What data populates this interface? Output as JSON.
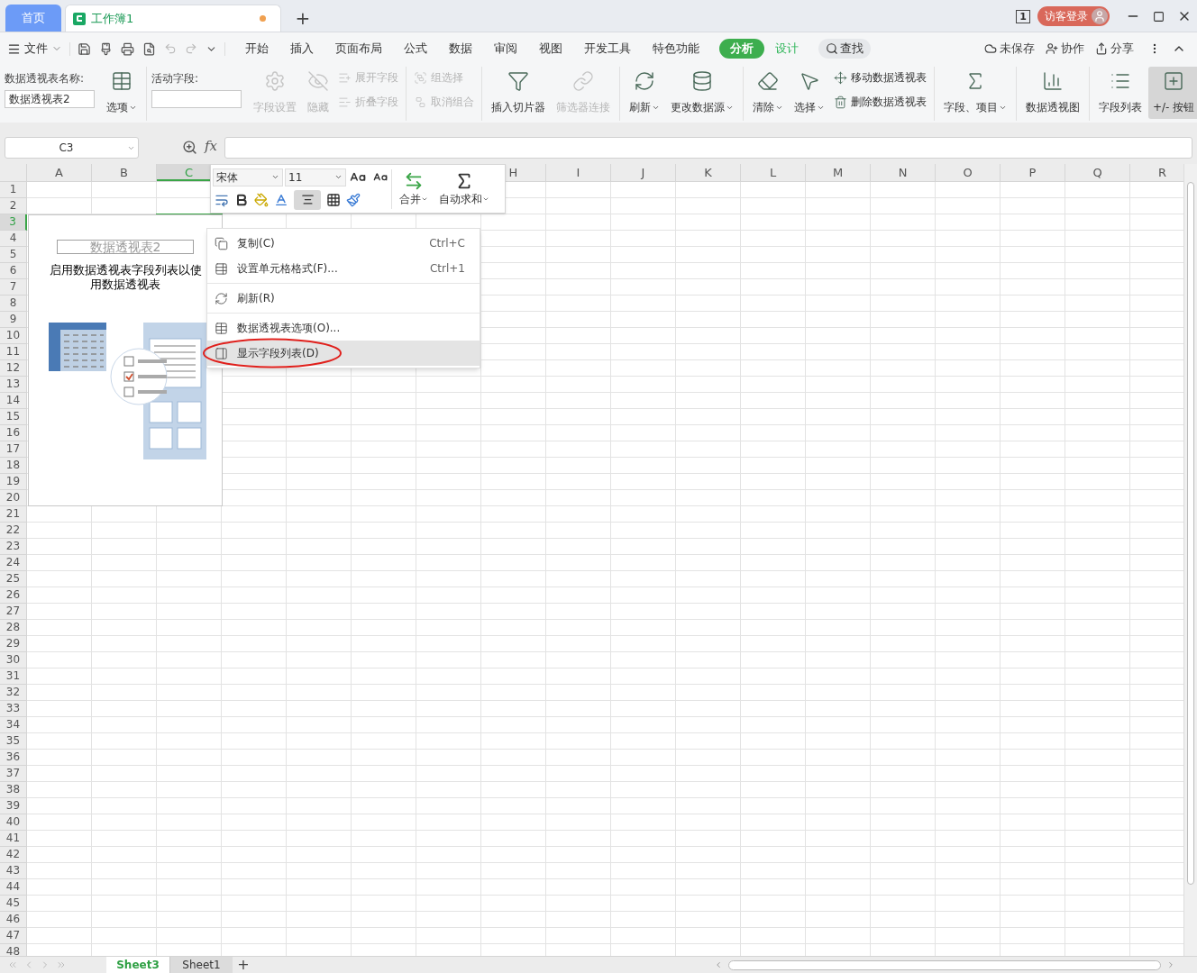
{
  "title_bar": {
    "tabs": [
      {
        "label": "首页",
        "kind": "home",
        "selected": false,
        "unsaved": false
      },
      {
        "label": "工作簿1",
        "kind": "document",
        "selected": true,
        "unsaved": true
      }
    ],
    "new_tab": "+",
    "window_count": "1",
    "login": "访客登录"
  },
  "menu": {
    "file": "文件",
    "tabs": [
      {
        "label": "开始",
        "kind": "normal",
        "selected": false
      },
      {
        "label": "插入",
        "kind": "normal",
        "selected": false
      },
      {
        "label": "页面布局",
        "kind": "normal",
        "selected": false
      },
      {
        "label": "公式",
        "kind": "normal",
        "selected": false
      },
      {
        "label": "数据",
        "kind": "normal",
        "selected": false
      },
      {
        "label": "审阅",
        "kind": "normal",
        "selected": false
      },
      {
        "label": "视图",
        "kind": "normal",
        "selected": false
      },
      {
        "label": "开发工具",
        "kind": "normal",
        "selected": false
      },
      {
        "label": "特色功能",
        "kind": "normal",
        "selected": false
      },
      {
        "label": "分析",
        "kind": "contextual",
        "selected": true
      },
      {
        "label": "设计",
        "kind": "contextual",
        "selected": false
      }
    ],
    "search": "查找",
    "actions": [
      "未保存",
      "协作",
      "分享"
    ]
  },
  "ribbon": {
    "groups": [
      [
        {
          "kind": "field",
          "label": "数据透视表名称:",
          "value": "数据透视表2"
        },
        {
          "kind": "large",
          "label": "选项",
          "disabled": false,
          "dropdown": true,
          "pressed": false
        }
      ],
      [
        {
          "kind": "field",
          "label": "活动字段:"
        },
        {
          "kind": "large",
          "label": "字段设置",
          "disabled": true,
          "dropdown": false,
          "pressed": false
        },
        {
          "kind": "large",
          "label": "隐藏",
          "disabled": true,
          "dropdown": false,
          "pressed": false
        },
        {
          "kind": "small",
          "label": "展开字段",
          "disabled": true,
          "dropdown": false,
          "pressed": false
        },
        {
          "kind": "small",
          "label": "折叠字段",
          "disabled": true,
          "dropdown": false,
          "pressed": false
        }
      ],
      [
        {
          "kind": "small",
          "label": "组选择",
          "disabled": true,
          "dropdown": false,
          "pressed": false
        },
        {
          "kind": "small",
          "label": "取消组合",
          "disabled": true,
          "dropdown": false,
          "pressed": false
        }
      ],
      [
        {
          "kind": "large",
          "label": "插入切片器",
          "disabled": false,
          "dropdown": false,
          "pressed": false
        },
        {
          "kind": "large",
          "label": "筛选器连接",
          "disabled": true,
          "dropdown": false,
          "pressed": false
        }
      ],
      [
        {
          "kind": "large",
          "label": "刷新",
          "disabled": false,
          "dropdown": true,
          "pressed": false
        },
        {
          "kind": "large",
          "label": "更改数据源",
          "disabled": false,
          "dropdown": true,
          "pressed": false
        }
      ],
      [
        {
          "kind": "large",
          "label": "清除",
          "disabled": false,
          "dropdown": true,
          "pressed": false
        },
        {
          "kind": "large",
          "label": "选择",
          "disabled": false,
          "dropdown": true,
          "pressed": false
        },
        {
          "kind": "small",
          "label": "移动数据透视表",
          "disabled": false,
          "dropdown": false,
          "pressed": false
        },
        {
          "kind": "small",
          "label": "删除数据透视表",
          "disabled": false,
          "dropdown": false,
          "pressed": false
        }
      ],
      [
        {
          "kind": "large",
          "label": "字段、项目",
          "disabled": false,
          "dropdown": true,
          "pressed": false
        }
      ],
      [
        {
          "kind": "large",
          "label": "数据透视图",
          "disabled": false,
          "dropdown": false,
          "pressed": false
        }
      ],
      [
        {
          "kind": "large",
          "label": "字段列表",
          "disabled": false,
          "dropdown": false,
          "pressed": false
        },
        {
          "kind": "large",
          "label": "+/- 按钮",
          "disabled": false,
          "dropdown": false,
          "pressed": true
        }
      ]
    ]
  },
  "formula_bar": {
    "name_box": "C3",
    "fx": "fx"
  },
  "sheet": {
    "columns": [
      {
        "label": "A",
        "selected": false
      },
      {
        "label": "B",
        "selected": false
      },
      {
        "label": "C",
        "selected": true
      },
      {},
      {},
      {},
      {},
      {
        "label": "H",
        "selected": false
      },
      {
        "label": "I",
        "selected": false
      },
      {
        "label": "J",
        "selected": false
      },
      {
        "label": "K",
        "selected": false
      },
      {
        "label": "L",
        "selected": false
      },
      {
        "label": "M",
        "selected": false
      },
      {
        "label": "N",
        "selected": false
      },
      {
        "label": "O",
        "selected": false
      },
      {
        "label": "P",
        "selected": false
      },
      {
        "label": "Q",
        "selected": false
      },
      {
        "label": "R",
        "selected": false
      }
    ],
    "rows": [
      {
        "label": "1",
        "selected": false
      },
      {
        "label": "2",
        "selected": false
      },
      {
        "label": "3",
        "selected": true
      },
      {
        "label": "4",
        "selected": false
      },
      {
        "label": "5",
        "selected": false
      },
      {
        "label": "6",
        "selected": false
      },
      {
        "label": "7",
        "selected": false
      },
      {
        "label": "8",
        "selected": false
      },
      {
        "label": "9",
        "selected": false
      },
      {
        "label": "10",
        "selected": false
      },
      {
        "label": "11",
        "selected": false
      },
      {
        "label": "12",
        "selected": false
      },
      {
        "label": "13",
        "selected": false
      },
      {
        "label": "14",
        "selected": false
      },
      {
        "label": "15",
        "selected": false
      },
      {
        "label": "16",
        "selected": false
      },
      {
        "label": "17",
        "selected": false
      },
      {
        "label": "18",
        "selected": false
      },
      {
        "label": "19",
        "selected": false
      },
      {
        "label": "20",
        "selected": false
      },
      {
        "label": "21",
        "selected": false
      },
      {
        "label": "22",
        "selected": false
      },
      {
        "label": "23",
        "selected": false
      },
      {
        "label": "24",
        "selected": false
      },
      {
        "label": "25",
        "selected": false
      },
      {
        "label": "26",
        "selected": false
      },
      {
        "label": "27",
        "selected": false
      },
      {
        "label": "28",
        "selected": false
      },
      {
        "label": "29",
        "selected": false
      },
      {
        "label": "30",
        "selected": false
      },
      {
        "label": "31",
        "selected": false
      },
      {
        "label": "32",
        "selected": false
      },
      {
        "label": "33",
        "selected": false
      },
      {
        "label": "34",
        "selected": false
      },
      {
        "label": "35",
        "selected": false
      },
      {
        "label": "36",
        "selected": false
      },
      {
        "label": "37",
        "selected": false
      },
      {
        "label": "38",
        "selected": false
      },
      {
        "label": "39",
        "selected": false
      },
      {
        "label": "40",
        "selected": false
      },
      {
        "label": "41",
        "selected": false
      },
      {
        "label": "42",
        "selected": false
      },
      {
        "label": "43",
        "selected": false
      },
      {
        "label": "44",
        "selected": false
      },
      {
        "label": "45",
        "selected": false
      },
      {
        "label": "46",
        "selected": false
      },
      {
        "label": "47",
        "selected": false
      },
      {
        "label": "48",
        "selected": false
      }
    ]
  },
  "pivot_placeholder": {
    "title": "数据透视表2",
    "description_lines": [
      "启用数据透视表字段列表以使",
      "用数据透视表"
    ]
  },
  "mini_toolbar": {
    "font": "宋体",
    "size": "11",
    "center_align_pressed": true,
    "merge": "合并",
    "autosum": "自动求和"
  },
  "context_menu": {
    "groups": [
      [
        {
          "label": "复制(C)",
          "shortcut": "Ctrl+C",
          "selected": false
        },
        {
          "label": "设置单元格格式(F)...",
          "shortcut": "Ctrl+1",
          "selected": false
        }
      ],
      [
        {
          "label": "刷新(R)",
          "selected": false
        }
      ],
      [
        {
          "label": "数据透视表选项(O)...",
          "selected": false
        },
        {
          "label": "显示字段列表(D)",
          "selected": true
        }
      ]
    ]
  },
  "sheet_tabs": {
    "tabs": [
      {
        "label": "Sheet3",
        "selected": true
      },
      {
        "label": "Sheet1",
        "selected": false
      }
    ],
    "add": "+"
  }
}
